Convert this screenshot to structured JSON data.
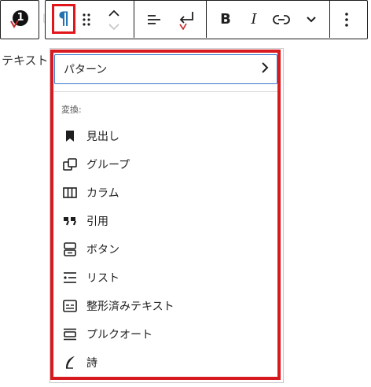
{
  "toolbar": {
    "block_number": "1",
    "paragraph_symbol": "¶",
    "bold_label": "B",
    "italic_label": "I"
  },
  "editor_text": "テキスト",
  "menu": {
    "pattern_label": "パターン",
    "section_label": "変換:",
    "items": [
      {
        "label": "見出し",
        "icon": "bookmark-icon"
      },
      {
        "label": "グループ",
        "icon": "group-icon"
      },
      {
        "label": "カラム",
        "icon": "columns-icon"
      },
      {
        "label": "引用",
        "icon": "quote-icon"
      },
      {
        "label": "ボタン",
        "icon": "buttons-icon"
      },
      {
        "label": "リスト",
        "icon": "list-icon"
      },
      {
        "label": "整形済みテキスト",
        "icon": "preformatted-icon"
      },
      {
        "label": "プルクオート",
        "icon": "pullquote-icon"
      },
      {
        "label": "詩",
        "icon": "verse-icon"
      }
    ]
  },
  "colors": {
    "highlight_red": "#d61a1f",
    "accent_blue": "#2271b1"
  }
}
